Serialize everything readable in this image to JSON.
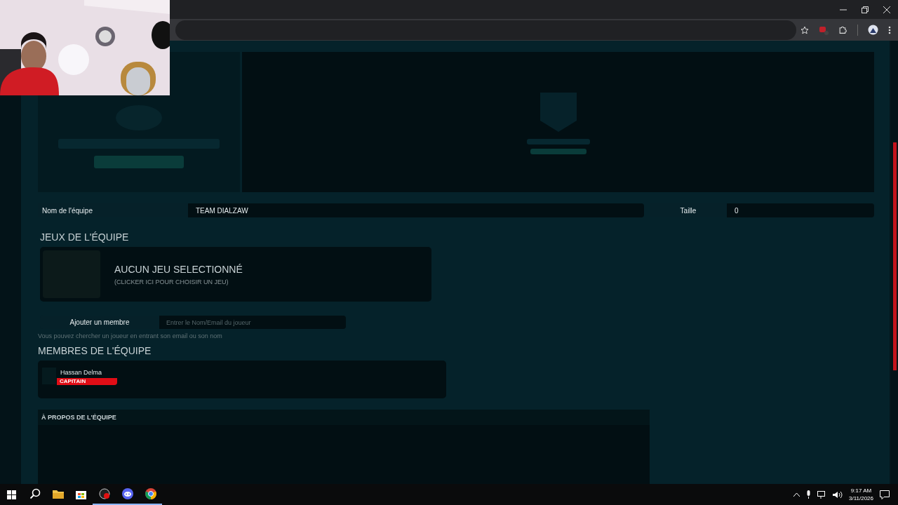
{
  "team": {
    "name_label": "Nom de l'équipe",
    "name_value": "TEAM DIALZAW",
    "size_label": "Taille",
    "size_value": "0"
  },
  "games": {
    "heading": "JEUX DE L'ÉQUIPE",
    "card_title": "AUCUN JEU SELECTIONNÉ",
    "card_hint": "(CLICKER ICI POUR CHOISIR UN JEU)"
  },
  "add_member": {
    "label": "Ajouter un membre",
    "placeholder": "Entrer le Nom/Email du joueur",
    "hint": "Vous pouvez chercher un joueur en entrant son email ou son nom"
  },
  "members": {
    "heading": "MEMBRES DE L'ÉQUIPE",
    "items": [
      {
        "name": "Hassan Delma",
        "role": "CAPITAIN"
      }
    ]
  },
  "about": {
    "heading": "À PROPOS DE L'ÉQUIPE"
  },
  "taskbar": {
    "apps": [
      {
        "kind": "search",
        "selected": false
      },
      {
        "kind": "folder",
        "selected": false
      },
      {
        "kind": "store",
        "selected": false
      },
      {
        "kind": "recorder",
        "selected": true
      },
      {
        "kind": "chat",
        "selected": true
      },
      {
        "kind": "browser",
        "selected": true
      }
    ],
    "time": "9:17 AM",
    "date": "3/11/2026"
  }
}
